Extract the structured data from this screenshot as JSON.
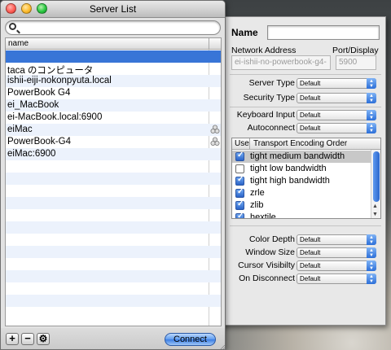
{
  "window": {
    "title": "Server List",
    "traffic_lights": {
      "close": "#ff5f57",
      "minimize": "#febc2e",
      "zoom": "#28c840"
    }
  },
  "search": {
    "placeholder": "",
    "value": "",
    "icon": "magnifier-icon"
  },
  "server_list": {
    "column_header": "name",
    "selected_index": 0,
    "rows": [
      {
        "name": "",
        "shared": false
      },
      {
        "name": "taca のコンピュータ",
        "shared": false
      },
      {
        "name": "ishii-eiji-nokonpyuta.local",
        "shared": false
      },
      {
        "name": "PowerBook G4",
        "shared": false
      },
      {
        "name": "ei_MacBook",
        "shared": false
      },
      {
        "name": "ei-MacBook.local:6900",
        "shared": false
      },
      {
        "name": "eiMac",
        "shared": true
      },
      {
        "name": "PowerBook-G4",
        "shared": true
      },
      {
        "name": "eiMac:6900",
        "shared": false
      }
    ]
  },
  "toolbar": {
    "add_label": "+",
    "remove_label": "−",
    "action_icon": "gear-icon",
    "connect_label": "Connect"
  },
  "drawer": {
    "name_label": "Name",
    "name_value": "",
    "network_address_label": "Network Address",
    "network_address_value": "ei-ishii-no-powerbook-g4-",
    "port_label": "Port/Display",
    "port_value": "5900",
    "server_type_label": "Server Type",
    "server_type_value": "Default",
    "security_type_label": "Security Type",
    "security_type_value": "Default",
    "keyboard_input_label": "Keyboard Input",
    "keyboard_input_value": "Default",
    "autoconnect_label": "Autoconnect",
    "autoconnect_value": "Default",
    "encodings": {
      "use_header": "Use",
      "order_header": "Transport Encoding Order",
      "items": [
        {
          "label": "tight medium bandwidth",
          "checked": true,
          "selected": true
        },
        {
          "label": "tight low bandwidth",
          "checked": false,
          "selected": false
        },
        {
          "label": "tight high bandwidth",
          "checked": true,
          "selected": false
        },
        {
          "label": "zrle",
          "checked": true,
          "selected": false
        },
        {
          "label": "zlib",
          "checked": true,
          "selected": false
        },
        {
          "label": "hextile",
          "checked": true,
          "selected": false
        }
      ]
    },
    "color_depth_label": "Color Depth",
    "color_depth_value": "Default",
    "window_size_label": "Window Size",
    "window_size_value": "Default",
    "cursor_visibility_label": "Cursor Visibilty",
    "cursor_visibility_value": "Default",
    "on_disconnect_label": "On Disconnect",
    "on_disconnect_value": "Default"
  },
  "colors": {
    "selection": "#3875d7",
    "alt_row": "#ecf2fc",
    "accent": "#2a66cc"
  }
}
